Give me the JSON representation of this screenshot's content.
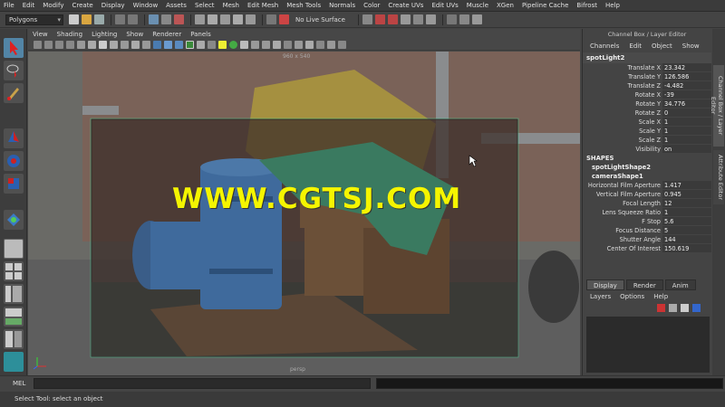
{
  "menubar": {
    "items": [
      "File",
      "Edit",
      "Modify",
      "Create",
      "Display",
      "Window",
      "Assets",
      "Select",
      "Mesh",
      "Edit Mesh",
      "Mesh Tools",
      "Normals",
      "Color",
      "Create UVs",
      "Edit UVs",
      "Muscle",
      "XGen",
      "Pipeline Cache",
      "Bifrost",
      "Help"
    ]
  },
  "statusline": {
    "mode": "Polygons",
    "live_surface": "No Live Surface"
  },
  "viewport": {
    "menu": [
      "View",
      "Shading",
      "Lighting",
      "Show",
      "Renderer",
      "Panels"
    ],
    "resolution_gate": "960 x 540",
    "camera": "persp"
  },
  "channelbox": {
    "title": "Channel Box / Layer Editor",
    "menu": [
      "Channels",
      "Edit",
      "Object",
      "Show"
    ],
    "object": "spotLight2",
    "attributes": [
      {
        "name": "Translate X",
        "value": "23.342"
      },
      {
        "name": "Translate Y",
        "value": "126.586"
      },
      {
        "name": "Translate Z",
        "value": "-4.482"
      },
      {
        "name": "Rotate X",
        "value": "-39"
      },
      {
        "name": "Rotate Y",
        "value": "34.776"
      },
      {
        "name": "Rotate Z",
        "value": "0"
      },
      {
        "name": "Scale X",
        "value": "1"
      },
      {
        "name": "Scale Y",
        "value": "1"
      },
      {
        "name": "Scale Z",
        "value": "1"
      },
      {
        "name": "Visibility",
        "value": "on"
      }
    ],
    "shapes_label": "SHAPES",
    "shape1": "spotLightShape2",
    "shape2": "cameraShape1",
    "shape_attributes": [
      {
        "name": "Horizontal Film Aperture",
        "value": "1.417"
      },
      {
        "name": "Vertical Film Aperture",
        "value": "0.945"
      },
      {
        "name": "Focal Length",
        "value": "12"
      },
      {
        "name": "Lens Squeeze Ratio",
        "value": "1"
      },
      {
        "name": "F Stop",
        "value": "5.6"
      },
      {
        "name": "Focus Distance",
        "value": "5"
      },
      {
        "name": "Shutter Angle",
        "value": "144"
      },
      {
        "name": "Center Of Interest",
        "value": "150.619"
      }
    ]
  },
  "layereditor": {
    "tabs": [
      "Display",
      "Render",
      "Anim"
    ],
    "menu": [
      "Layers",
      "Options",
      "Help"
    ]
  },
  "sidetabs": {
    "channel_box": "Channel Box / Layer Editor",
    "attribute_editor": "Attribute Editor"
  },
  "commandline": {
    "label": "MEL"
  },
  "helpline": {
    "text": "Select Tool: select an object"
  },
  "watermark": "WWW.CGTSJ.COM",
  "colors": {
    "ui_bg": "#444444",
    "highlight": "#5285a6",
    "watermark": "#f5f500"
  }
}
